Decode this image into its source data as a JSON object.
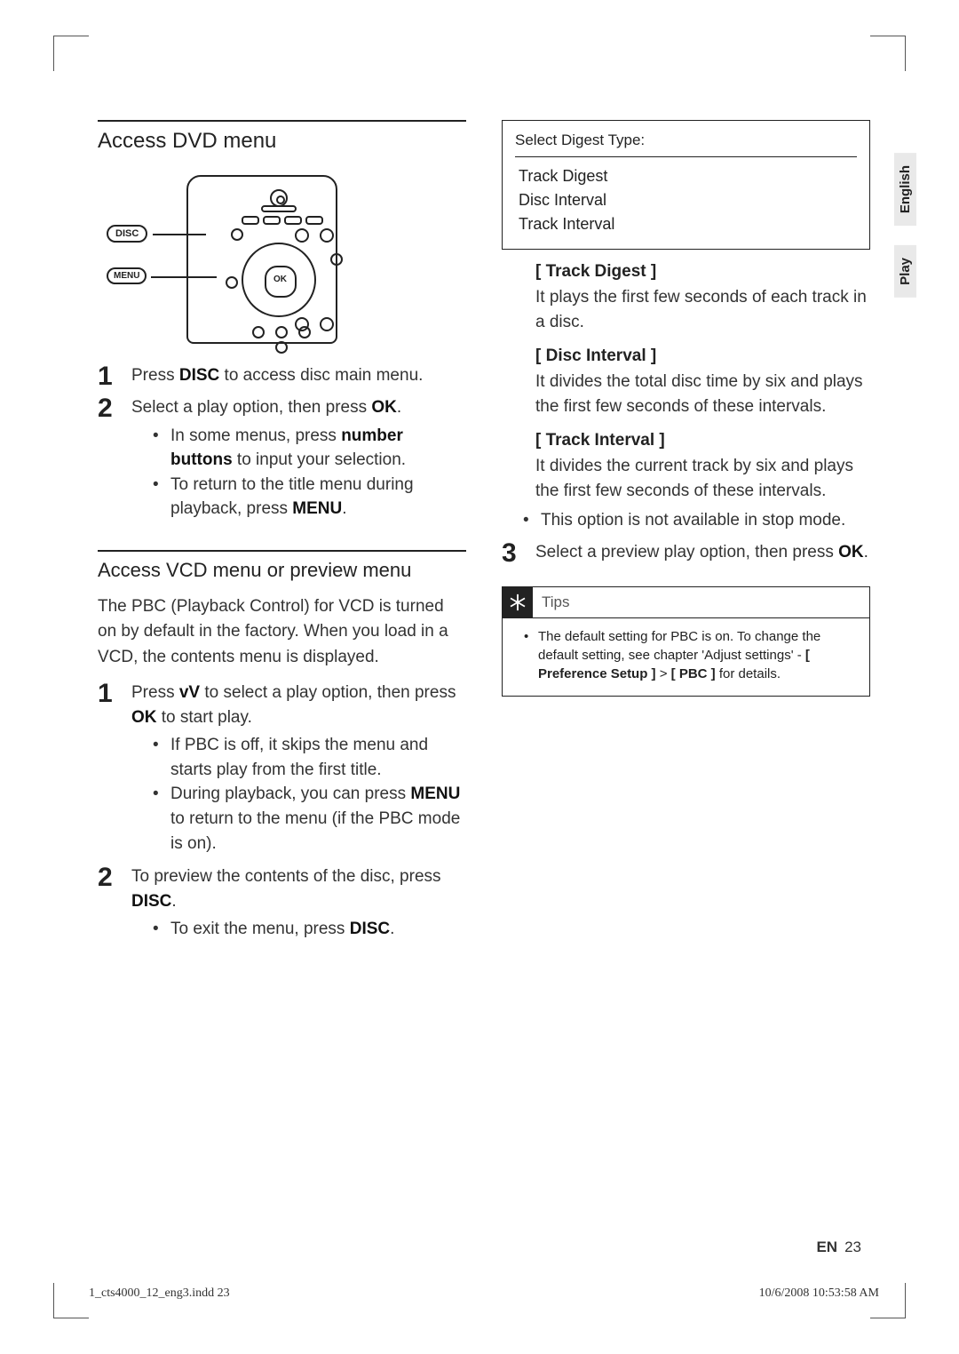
{
  "sideTabs": {
    "tab1": "English",
    "tab2": "Play"
  },
  "left": {
    "h1": "Access DVD menu",
    "remote_disc": "DISC",
    "remote_menu": "MENU",
    "remote_ok": "OK",
    "steps1": {
      "s1": {
        "num": "1",
        "pre": "Press ",
        "bold": "DISC",
        "post": " to access disc main menu."
      },
      "s2": {
        "num": "2",
        "text_a": "Select a play option, then press ",
        "text_b": "OK",
        "text_c": ".",
        "b1_a": "In some menus, press ",
        "b1_b": "number buttons",
        "b1_c": " to input your selection.",
        "b2_a": "To return to the title menu during playback, press ",
        "b2_b": "MENU",
        "b2_c": "."
      }
    },
    "h2": "Access VCD menu or preview menu",
    "intro": "The PBC (Playback Control) for VCD is turned on by default in the factory. When you load in a VCD, the contents menu is displayed.",
    "steps2": {
      "s1": {
        "num": "1",
        "a": "Press ",
        "b": "vV",
        "c": " to select a play option, then press ",
        "d": "OK",
        "e": " to start play.",
        "b1": "If PBC is off, it skips the menu and starts play from the ﬁrst title.",
        "b2_a": "During playback, you can press ",
        "b2_b": "MENU",
        "b2_c": " to return to the menu (if the PBC mode is on)."
      },
      "s2": {
        "num": "2",
        "a": "To preview the contents of the disc, press ",
        "b": "DISC",
        "c": ".",
        "b1_a": "To exit the menu, press ",
        "b1_b": "DISC",
        "b1_c": "."
      }
    }
  },
  "right": {
    "osd": {
      "head": "Select Digest Type:",
      "i1": "Track Digest",
      "i2": "Disc Interval",
      "i3": "Track Interval"
    },
    "opt1_h": "[ Track Digest ]",
    "opt1_d": "It plays the ﬁrst few seconds of each track in a disc.",
    "opt2_h": "[ Disc Interval ]",
    "opt2_d": "It divides the total disc time by six and plays the ﬁrst few seconds of these intervals.",
    "opt3_h": "[ Track Interval ]",
    "opt3_d": "It divides the current track by six and plays the ﬁrst few seconds of these intervals.",
    "opt3_b1": "This option is not available in stop mode.",
    "s3": {
      "num": "3",
      "a": "Select a preview play option, then press ",
      "b": "OK",
      "c": "."
    },
    "tips_title": "Tips",
    "tips_a": "The default setting for PBC is on. To change the default setting, see chapter 'Adjust settings' - ",
    "tips_b": "[ Preference Setup ]",
    "tips_c": " > ",
    "tips_d": "[ PBC ]",
    "tips_e": " for details."
  },
  "footer": {
    "left": "1_cts4000_12_eng3.indd   23",
    "right": "10/6/2008   10:53:58 AM",
    "lang": "EN",
    "page": "23"
  }
}
